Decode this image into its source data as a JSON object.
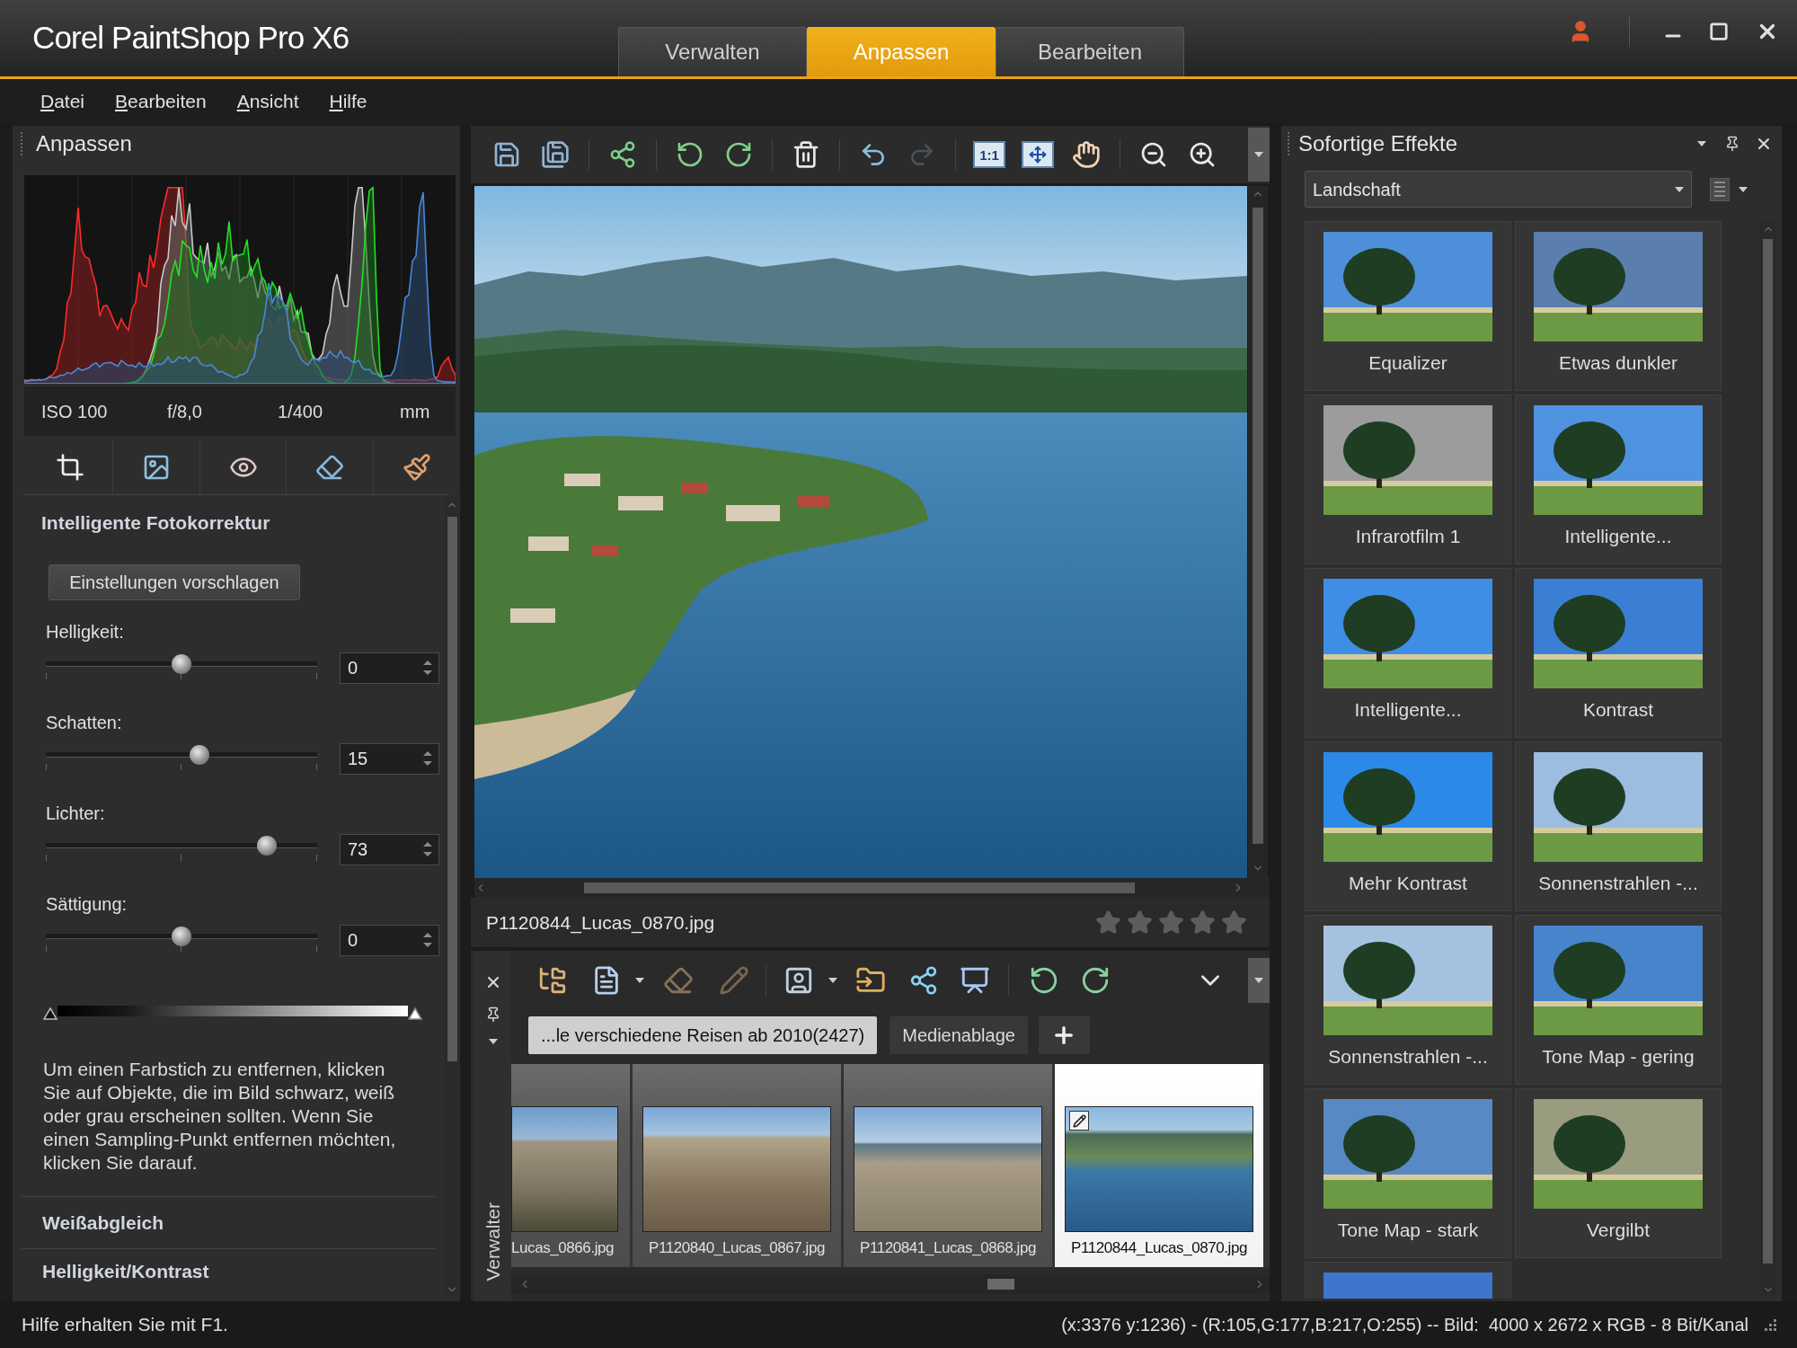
{
  "app": {
    "title": "Corel PaintShop Pro X6"
  },
  "workspace_tabs": [
    {
      "label": "Verwalten",
      "selected": false
    },
    {
      "label": "Anpassen",
      "selected": true
    },
    {
      "label": "Bearbeiten",
      "selected": false
    }
  ],
  "menu": [
    "Datei",
    "Bearbeiten",
    "Ansicht",
    "Hilfe"
  ],
  "adjust_panel": {
    "title": "Anpassen",
    "exif": [
      "ISO 100",
      "f/8,0",
      "1/400",
      "mm"
    ],
    "section": "Intelligente Fotokorrektur",
    "suggest_button": "Einstellungen vorschlagen",
    "sliders": [
      {
        "label": "Helligkeit:",
        "value": "0",
        "level": 0.5
      },
      {
        "label": "Schatten:",
        "value": "15",
        "level": 0.57
      },
      {
        "label": "Lichter:",
        "value": "73",
        "level": 0.84
      },
      {
        "label": "Sättigung:",
        "value": "0",
        "level": 0.5
      }
    ],
    "hint": "Um einen Farbstich zu entfernen, klicken Sie auf Objekte, die im Bild schwarz, weiß oder grau erscheinen sollten. Wenn Sie einen Sampling-Punkt entfernen möchten, klicken Sie darauf.",
    "sections": [
      "Weißabgleich",
      "Helligkeit/Kontrast"
    ]
  },
  "toolbar": [
    [
      {
        "kind": "save",
        "disabled": false
      },
      {
        "kind": "save_as",
        "disabled": false
      }
    ],
    [
      {
        "kind": "share",
        "disabled": false
      }
    ],
    [
      {
        "kind": "rotate_left",
        "disabled": false
      },
      {
        "kind": "rotate_right",
        "disabled": false
      }
    ],
    [
      {
        "kind": "delete",
        "disabled": false
      }
    ],
    [
      {
        "kind": "undo",
        "disabled": false
      },
      {
        "kind": "redo",
        "disabled": true
      }
    ],
    [
      {
        "kind": "actual_size",
        "label": "1:1",
        "disabled": false
      },
      {
        "kind": "fit",
        "disabled": false
      },
      {
        "kind": "pan",
        "disabled": false
      }
    ],
    [
      {
        "kind": "zoom_out",
        "disabled": false
      },
      {
        "kind": "zoom_in",
        "disabled": false
      }
    ]
  ],
  "image_view": {
    "filename": "P1120844_Lucas_0870.jpg",
    "stars": 0
  },
  "organizer": {
    "side_label": "Verwalter",
    "tabs": [
      {
        "label": "...le verschiedene Reisen ab 2010(2427)",
        "selected": true
      },
      {
        "label": "Medienablage",
        "selected": false
      }
    ],
    "thumbnails": [
      {
        "filename": "Lucas_0866.jpg",
        "selected": false,
        "edited": false
      },
      {
        "filename": "P1120840_Lucas_0867.jpg",
        "selected": false,
        "edited": false
      },
      {
        "filename": "P1120841_Lucas_0868.jpg",
        "selected": false,
        "edited": false
      },
      {
        "filename": "P1120844_Lucas_0870.jpg",
        "selected": true,
        "edited": true
      }
    ]
  },
  "effects_panel": {
    "title": "Sofortige Effekte",
    "category": "Landschaft",
    "presets": [
      {
        "kind": "preset",
        "label": "Equalizer",
        "color": "#4d8fd8"
      },
      {
        "kind": "preset",
        "label": "Etwas dunkler",
        "color": "#5a7fae"
      },
      {
        "kind": "preset",
        "label": "Infrarotfilm 1",
        "color": "#9c9c9c"
      },
      {
        "kind": "preset",
        "label": "Intelligente...",
        "color": "#4f92e0"
      },
      {
        "kind": "preset",
        "label": "Intelligente...",
        "color": "#3f8ee6"
      },
      {
        "kind": "preset",
        "label": "Kontrast",
        "color": "#3a7fd4"
      },
      {
        "kind": "preset",
        "label": "Mehr Kontrast",
        "color": "#2b8ae8"
      },
      {
        "kind": "preset",
        "label": "Sonnenstrahlen -...",
        "color": "#9cbce0"
      },
      {
        "kind": "preset",
        "label": "Sonnenstrahlen -...",
        "color": "#a4c2e0"
      },
      {
        "kind": "preset",
        "label": "Tone Map - gering",
        "color": "#4784cc"
      },
      {
        "kind": "preset",
        "label": "Tone Map - stark",
        "color": "#5889c4"
      },
      {
        "kind": "preset",
        "label": "Vergilbt",
        "color": "#9a9c80"
      },
      {
        "kind": "partial",
        "color": "#3d76cc"
      }
    ]
  },
  "status_bar": {
    "help": "Hilfe erhalten Sie mit F1.",
    "info": "(x:3376 y:1236) - (R:105,G:177,B:217,O:255) -- Bild:  4000 x 2672 x RGB - 8 Bit/Kanal"
  }
}
